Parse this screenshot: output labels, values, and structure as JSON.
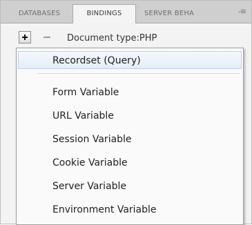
{
  "tabs": [
    {
      "label": "DATABASES"
    },
    {
      "label": "BINDINGS"
    },
    {
      "label": "SERVER BEHA"
    }
  ],
  "panel_menu_glyph": "-≡",
  "toolbar": {
    "document_type": "Document type:PHP"
  },
  "menu": {
    "items": [
      {
        "label": "Recordset (Query)"
      },
      {
        "label": "Form Variable"
      },
      {
        "label": "URL Variable"
      },
      {
        "label": "Session Variable"
      },
      {
        "label": "Cookie Variable"
      },
      {
        "label": "Server Variable"
      },
      {
        "label": "Environment Variable"
      }
    ]
  }
}
